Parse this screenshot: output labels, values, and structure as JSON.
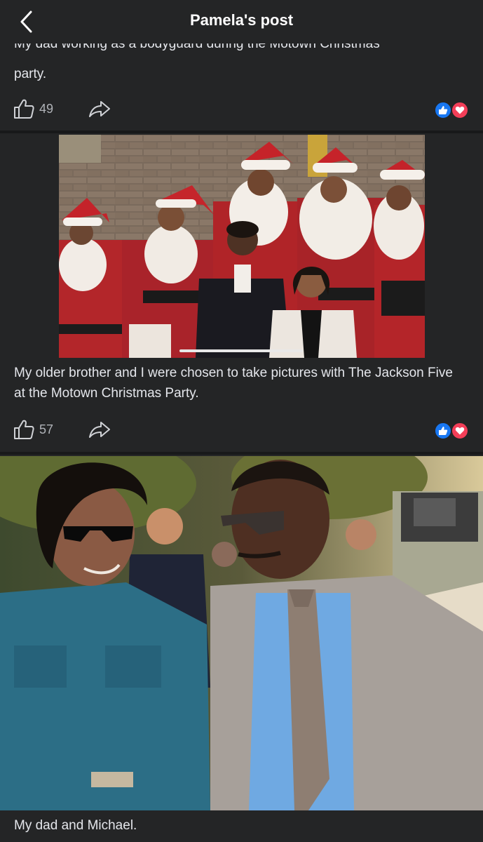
{
  "header": {
    "title": "Pamela's post",
    "back_icon": "chevron-left-icon"
  },
  "posts": [
    {
      "caption_line1": "My dad working as a bodyguard during the Motown Christmas",
      "caption_line2": "party.",
      "like_count": "49"
    },
    {
      "caption": "My older brother and I were chosen to take pictures with The Jackson Five at the Motown Christmas Party.",
      "like_count": "57"
    },
    {
      "caption": "My dad and Michael."
    }
  ],
  "colors": {
    "background": "#242526",
    "divider": "#18191a",
    "like_reaction": "#1877f2",
    "love_reaction": "#f33e58"
  }
}
